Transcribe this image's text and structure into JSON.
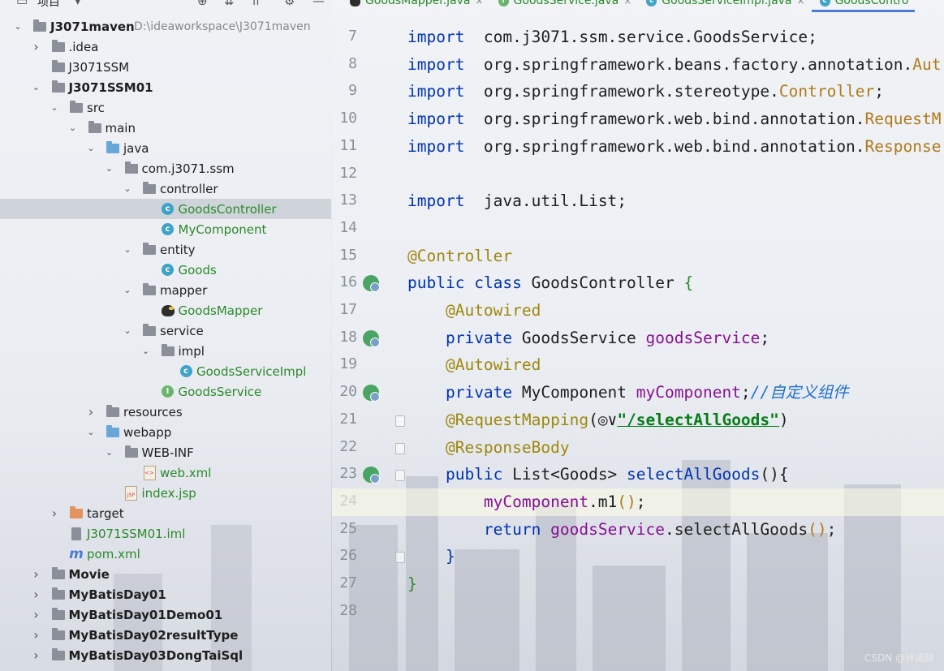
{
  "project_panel": {
    "header_label": "项目",
    "tree": [
      {
        "label": "J3071maven",
        "path": "D:\\ideaworkspace\\J3071maven",
        "depth": 0,
        "arrow": "down",
        "icon": "module",
        "bold": true
      },
      {
        "label": ".idea",
        "depth": 1,
        "arrow": "right",
        "icon": "folder"
      },
      {
        "label": "J3071SSM",
        "depth": 1,
        "arrow": "",
        "icon": "folder"
      },
      {
        "label": "J3071SSM01",
        "depth": 1,
        "arrow": "down",
        "icon": "module",
        "bold": true
      },
      {
        "label": "src",
        "depth": 2,
        "arrow": "down",
        "icon": "folder"
      },
      {
        "label": "main",
        "depth": 3,
        "arrow": "down",
        "icon": "folder"
      },
      {
        "label": "java",
        "depth": 4,
        "arrow": "down",
        "icon": "folder-blue"
      },
      {
        "label": "com.j3071.ssm",
        "depth": 5,
        "arrow": "down",
        "icon": "folder"
      },
      {
        "label": "controller",
        "depth": 6,
        "arrow": "down",
        "icon": "folder"
      },
      {
        "label": "GoodsController",
        "depth": 7,
        "arrow": "",
        "icon": "class",
        "green": true,
        "selected": true
      },
      {
        "label": "MyComponent",
        "depth": 7,
        "arrow": "",
        "icon": "class",
        "green": true
      },
      {
        "label": "entity",
        "depth": 6,
        "arrow": "down",
        "icon": "folder"
      },
      {
        "label": "Goods",
        "depth": 7,
        "arrow": "",
        "icon": "class",
        "green": true
      },
      {
        "label": "mapper",
        "depth": 6,
        "arrow": "down",
        "icon": "folder"
      },
      {
        "label": "GoodsMapper",
        "depth": 7,
        "arrow": "",
        "icon": "mapper",
        "green": true
      },
      {
        "label": "service",
        "depth": 6,
        "arrow": "down",
        "icon": "folder"
      },
      {
        "label": "impl",
        "depth": 7,
        "arrow": "down",
        "icon": "folder"
      },
      {
        "label": "GoodsServiceImpl",
        "depth": 8,
        "arrow": "",
        "icon": "class",
        "green": true
      },
      {
        "label": "GoodsService",
        "depth": 7,
        "arrow": "",
        "icon": "interface",
        "green": true
      },
      {
        "label": "resources",
        "depth": 4,
        "arrow": "right",
        "icon": "folder"
      },
      {
        "label": "webapp",
        "depth": 4,
        "arrow": "down",
        "icon": "folder-web"
      },
      {
        "label": "WEB-INF",
        "depth": 5,
        "arrow": "down",
        "icon": "folder"
      },
      {
        "label": "web.xml",
        "depth": 6,
        "arrow": "",
        "icon": "xml",
        "green": true
      },
      {
        "label": "index.jsp",
        "depth": 5,
        "arrow": "",
        "icon": "jsp",
        "green": true
      },
      {
        "label": "target",
        "depth": 2,
        "arrow": "right",
        "icon": "folder-orange"
      },
      {
        "label": "J3071SSM01.iml",
        "depth": 2,
        "arrow": "",
        "icon": "iml",
        "green": true
      },
      {
        "label": "pom.xml",
        "depth": 2,
        "arrow": "",
        "icon": "maven",
        "green": true
      },
      {
        "label": "Movie",
        "depth": 1,
        "arrow": "right",
        "icon": "module",
        "bold": true
      },
      {
        "label": "MyBatisDay01",
        "depth": 1,
        "arrow": "right",
        "icon": "module",
        "bold": true
      },
      {
        "label": "MyBatisDay01Demo01",
        "depth": 1,
        "arrow": "right",
        "icon": "module",
        "bold": true
      },
      {
        "label": "MyBatisDay02resultType",
        "depth": 1,
        "arrow": "right",
        "icon": "module",
        "bold": true
      },
      {
        "label": "MyBatisDay03DongTaiSql",
        "depth": 1,
        "arrow": "right",
        "icon": "module",
        "bold": true
      }
    ]
  },
  "editor": {
    "tabs": [
      {
        "label": "GoodsMapper.java",
        "icon": "mapper",
        "active": false
      },
      {
        "label": "GoodsService.java",
        "icon": "interface",
        "active": false
      },
      {
        "label": "GoodsServiceImpl.java",
        "icon": "class",
        "active": false
      },
      {
        "label": "GoodsContro",
        "icon": "class",
        "active": true
      }
    ],
    "lines": [
      {
        "n": "7",
        "segs": [
          [
            "kw",
            "import"
          ],
          [
            "",
            "  com.j3071.ssm.service.GoodsService;"
          ]
        ]
      },
      {
        "n": "8",
        "segs": [
          [
            "kw",
            "import"
          ],
          [
            "",
            "  org.springframework.beans.factory.annotation."
          ],
          [
            "gold",
            "Aut"
          ]
        ]
      },
      {
        "n": "9",
        "segs": [
          [
            "kw",
            "import"
          ],
          [
            "",
            "  org.springframework.stereotype."
          ],
          [
            "gold",
            "Controller"
          ],
          [
            "",
            ";"
          ]
        ]
      },
      {
        "n": "10",
        "segs": [
          [
            "kw",
            "import"
          ],
          [
            "",
            "  org.springframework.web.bind.annotation."
          ],
          [
            "gold",
            "RequestM"
          ]
        ]
      },
      {
        "n": "11",
        "segs": [
          [
            "kw",
            "import"
          ],
          [
            "",
            "  org.springframework.web.bind.annotation."
          ],
          [
            "gold",
            "Response"
          ]
        ]
      },
      {
        "n": "12",
        "segs": []
      },
      {
        "n": "13",
        "segs": [
          [
            "kw",
            "import"
          ],
          [
            "",
            "  java.util.List;"
          ]
        ]
      },
      {
        "n": "14",
        "segs": []
      },
      {
        "n": "15",
        "segs": [
          [
            "ann",
            "@Controller"
          ]
        ]
      },
      {
        "n": "16",
        "segs": [
          [
            "kw",
            "public"
          ],
          [
            "",
            " "
          ],
          [
            "kw",
            "class"
          ],
          [
            "",
            " GoodsController "
          ],
          [
            "gbr",
            "{"
          ]
        ],
        "gicon": true
      },
      {
        "n": "17",
        "segs": [
          [
            "",
            "    "
          ],
          [
            "ann",
            "@Autowired"
          ]
        ]
      },
      {
        "n": "18",
        "segs": [
          [
            "",
            "    "
          ],
          [
            "kw",
            "private"
          ],
          [
            "",
            " GoodsService "
          ],
          [
            "fld",
            "goodsService"
          ],
          [
            "",
            ";"
          ]
        ],
        "gicon": true
      },
      {
        "n": "19",
        "segs": [
          [
            "",
            "    "
          ],
          [
            "ann",
            "@Autowired"
          ]
        ]
      },
      {
        "n": "20",
        "segs": [
          [
            "",
            "    "
          ],
          [
            "kw",
            "private"
          ],
          [
            "",
            " MyComponent "
          ],
          [
            "fld",
            "myComponent"
          ],
          [
            "",
            ";"
          ],
          [
            "cm",
            "//自定义组件"
          ]
        ],
        "gicon": true
      },
      {
        "n": "21",
        "segs": [
          [
            "",
            "    "
          ],
          [
            "ann",
            "@RequestMapping"
          ],
          [
            "",
            "(◎∨"
          ],
          [
            "str",
            "\"/selectAllGoods\""
          ],
          [
            "",
            ")"
          ]
        ],
        "fold": true
      },
      {
        "n": "22",
        "segs": [
          [
            "",
            "    "
          ],
          [
            "ann",
            "@ResponseBody"
          ]
        ],
        "fold": true
      },
      {
        "n": "23",
        "segs": [
          [
            "",
            "    "
          ],
          [
            "kw",
            "public"
          ],
          [
            "",
            " List<Goods> "
          ],
          [
            "kw",
            "selectAllGoods"
          ],
          [
            "",
            "(){"
          ]
        ],
        "gicon": true,
        "fold": true
      },
      {
        "n": "24",
        "segs": [
          [
            "",
            "        "
          ],
          [
            "fld",
            "myComponent"
          ],
          [
            "",
            ".m1"
          ],
          [
            "gold",
            "()"
          ],
          [
            "",
            ";"
          ]
        ],
        "highlight": true
      },
      {
        "n": "25",
        "segs": [
          [
            "",
            "        "
          ],
          [
            "kw",
            "return"
          ],
          [
            "",
            " "
          ],
          [
            "fld",
            "goodsService"
          ],
          [
            "",
            ".selectAllGoods"
          ],
          [
            "gold",
            "()"
          ],
          [
            "",
            ";"
          ]
        ]
      },
      {
        "n": "26",
        "segs": [
          [
            "",
            "    "
          ],
          [
            "kw",
            "}"
          ]
        ],
        "fold": true
      },
      {
        "n": "27",
        "segs": [
          [
            "gbr",
            "}"
          ]
        ]
      },
      {
        "n": "28",
        "segs": []
      }
    ]
  },
  "watermark": "CSDN @林诺辞"
}
